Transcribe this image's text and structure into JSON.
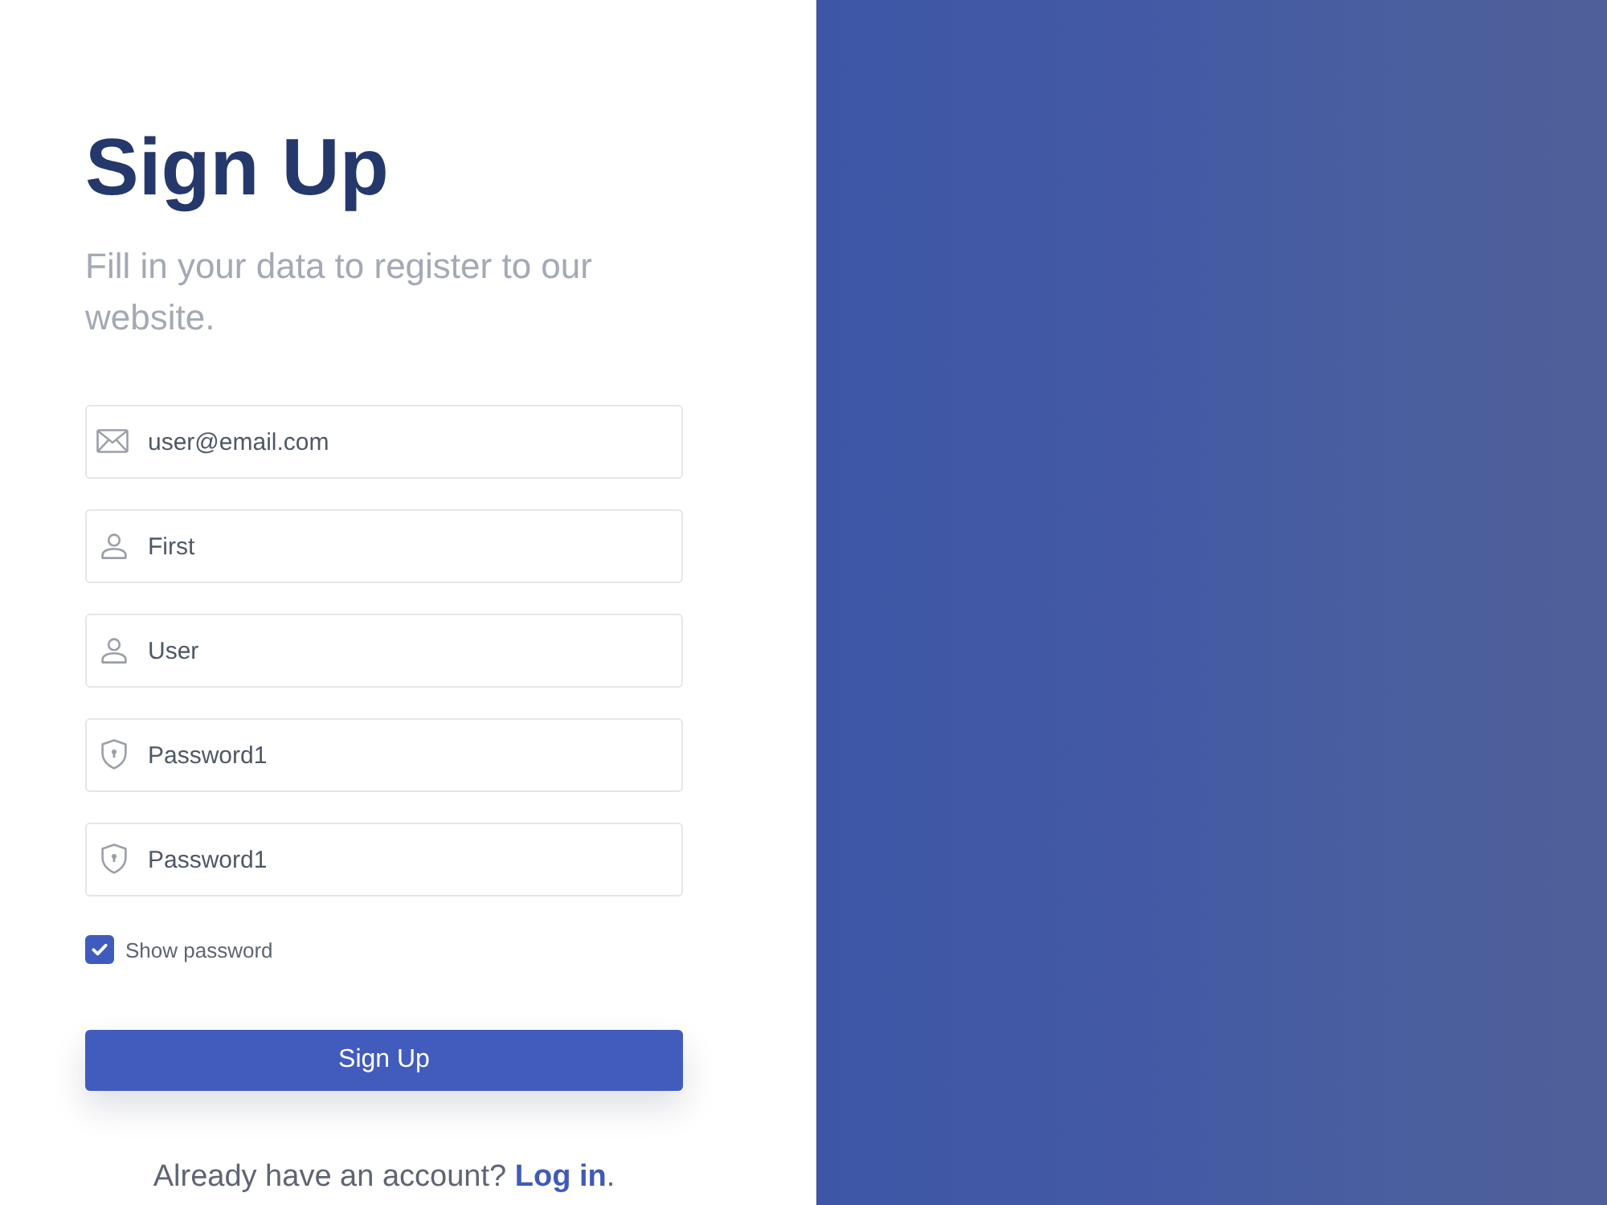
{
  "heading": {
    "title": "Sign Up",
    "subtitle": "Fill in your data to register to our website."
  },
  "fields": [
    {
      "kind": "email",
      "value": "user@email.com"
    },
    {
      "kind": "person",
      "value": "First"
    },
    {
      "kind": "person",
      "value": "User"
    },
    {
      "kind": "password",
      "value": "Password1"
    },
    {
      "kind": "password",
      "value": "Password1"
    }
  ],
  "show_password": {
    "label": "Show password",
    "checked": true
  },
  "submit_button": {
    "label": "Sign Up"
  },
  "login_prompt": {
    "text": "Already have an account?",
    "link": "Log in",
    "suffix": "."
  }
}
